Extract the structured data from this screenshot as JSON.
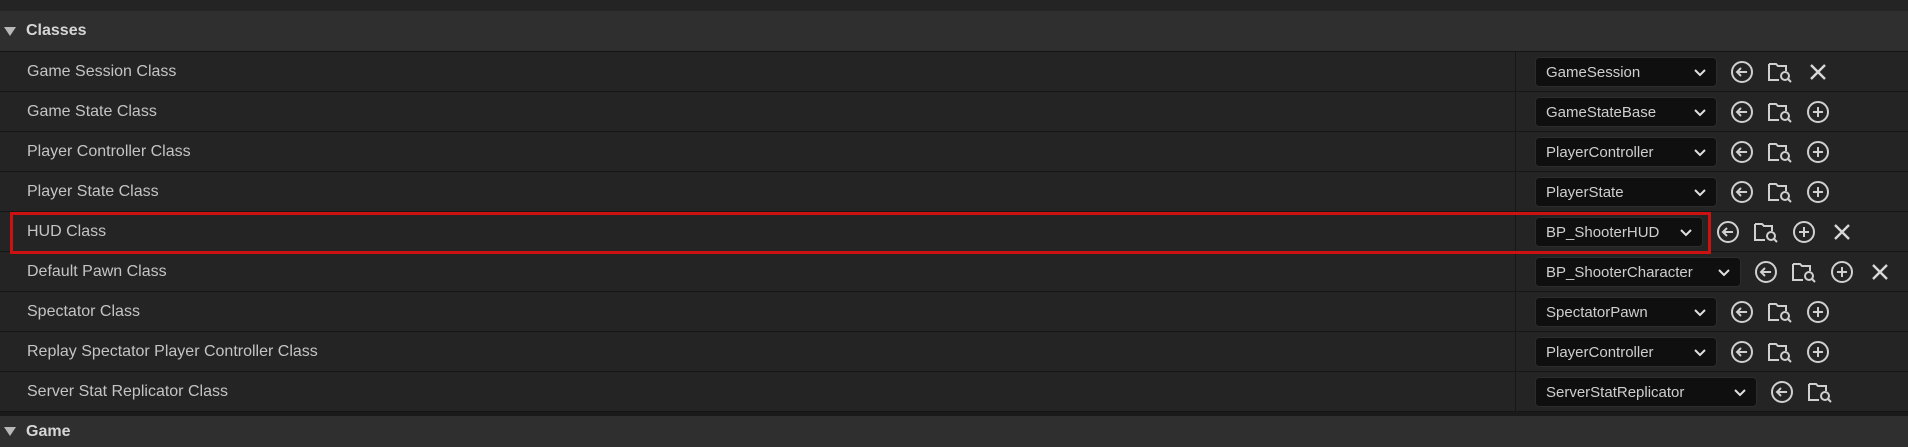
{
  "sections": {
    "classes_label": "Classes",
    "game_label": "Game"
  },
  "rows": [
    {
      "label": "Game Session Class",
      "value": "GameSession"
    },
    {
      "label": "Game State Class",
      "value": "GameStateBase"
    },
    {
      "label": "Player Controller Class",
      "value": "PlayerController"
    },
    {
      "label": "Player State Class",
      "value": "PlayerState"
    },
    {
      "label": "HUD Class",
      "value": "BP_ShooterHUD"
    },
    {
      "label": "Default Pawn Class",
      "value": "BP_ShooterCharacter"
    },
    {
      "label": "Spectator Class",
      "value": "SpectatorPawn"
    },
    {
      "label": "Replay Spectator Player Controller Class",
      "value": "PlayerController"
    },
    {
      "label": "Server Stat Replicator Class",
      "value": "ServerStatReplicator"
    }
  ],
  "icons": {
    "use_selected": "arrow-left-circle-icon",
    "browse": "folder-search-icon",
    "create_new": "plus-circle-icon",
    "clear": "close-icon",
    "collapse": "triangle-down-icon",
    "dropdown": "chevron-down-icon"
  },
  "colors": {
    "highlight_border": "#cc1111",
    "row_background": "#242424",
    "category_background": "#2f2f2f",
    "combo_background": "#0f0f0f"
  }
}
